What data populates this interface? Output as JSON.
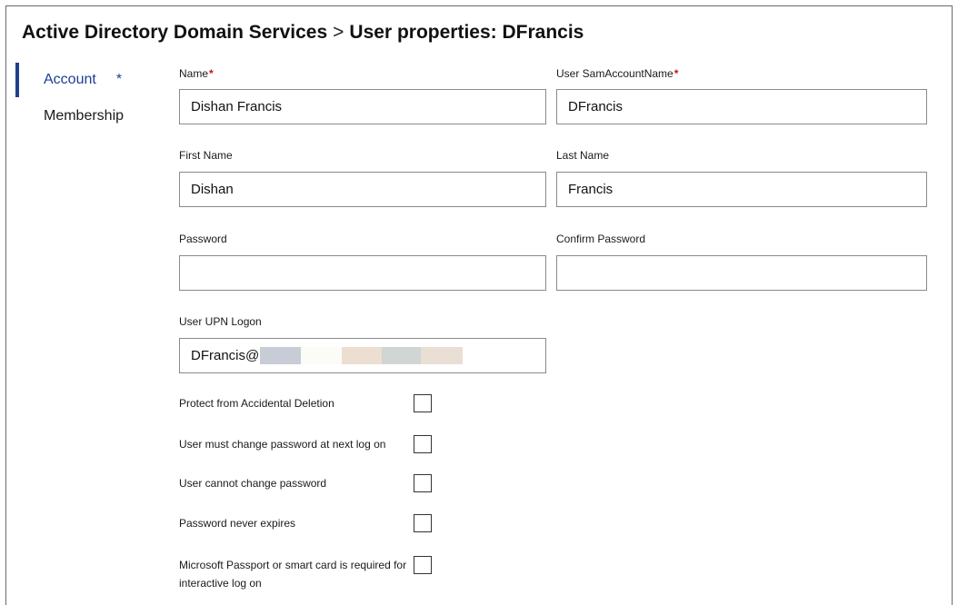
{
  "header": {
    "breadcrumb_parent": "Active Directory Domain Services",
    "separator": ">",
    "page_title": "User properties: DFrancis"
  },
  "nav": {
    "account_label": "Account",
    "account_marker": "*",
    "membership_label": "Membership"
  },
  "form": {
    "name": {
      "label": "Name",
      "required": "*",
      "value": "Dishan Francis"
    },
    "sam": {
      "label": "User SamAccountName",
      "required": "*",
      "value": "DFrancis"
    },
    "first_name": {
      "label": "First Name",
      "value": "Dishan"
    },
    "last_name": {
      "label": "Last Name",
      "value": "Francis"
    },
    "password": {
      "label": "Password",
      "value": ""
    },
    "confirm_password": {
      "label": "Confirm Password",
      "value": ""
    },
    "upn": {
      "label": "User UPN Logon",
      "value": "DFrancis@"
    }
  },
  "checkboxes": [
    {
      "label": "Protect from Accidental Deletion",
      "checked": false
    },
    {
      "label": "User must change password at next log on",
      "checked": false
    },
    {
      "label": "User cannot change password",
      "checked": false
    },
    {
      "label": "Password never expires",
      "checked": false
    },
    {
      "label": "Microsoft Passport or smart card is required for interactive log on",
      "checked": false
    }
  ],
  "colors": {
    "accent": "#1f3f8f",
    "required": "#c50f1f",
    "redaction": [
      "#c8ccd6",
      "#fbfbf7",
      "#ecdfd2",
      "#cfd6d3",
      "#eadfd4"
    ]
  }
}
